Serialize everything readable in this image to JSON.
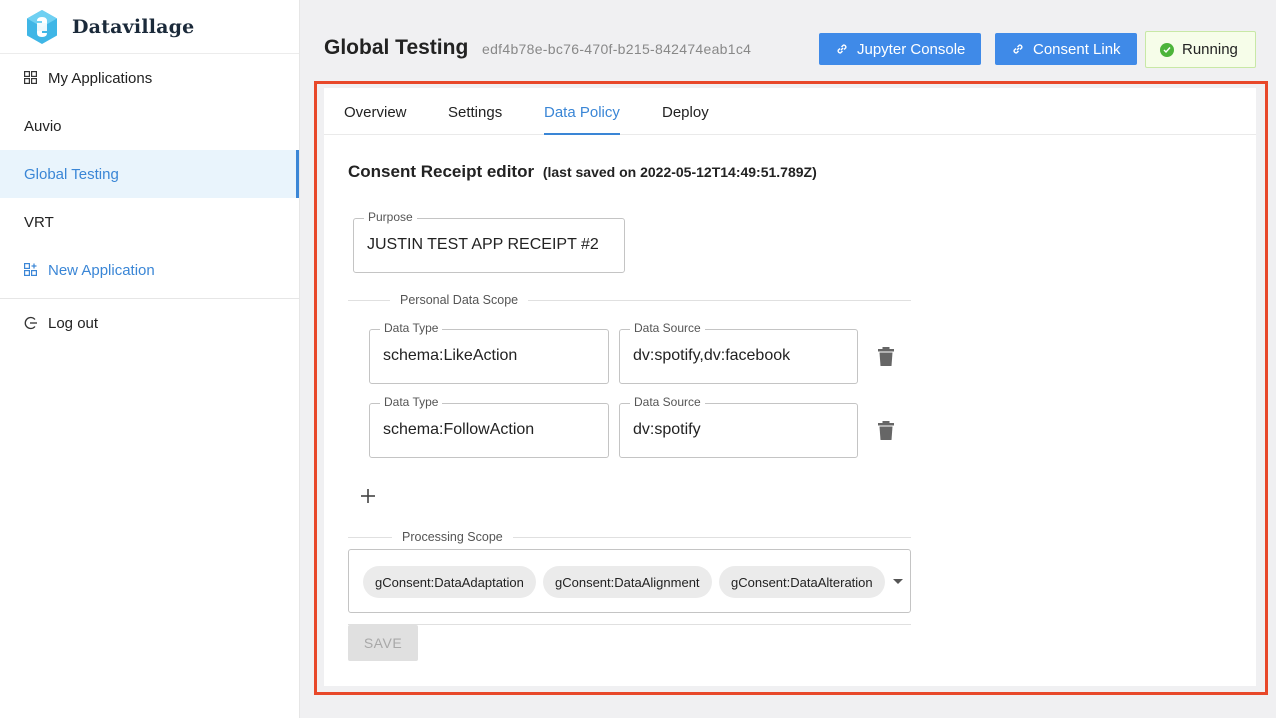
{
  "app": {
    "brand": "Datavillage"
  },
  "sidebar": {
    "items": [
      {
        "label": "My Applications",
        "icon": "grid-icon"
      },
      {
        "label": "Auvio"
      },
      {
        "label": "Global Testing",
        "active": true
      },
      {
        "label": "VRT"
      },
      {
        "label": "New Application",
        "icon": "add-app-icon"
      }
    ],
    "logout": {
      "label": "Log out",
      "icon": "logout-icon"
    }
  },
  "header": {
    "title": "Global Testing",
    "id": "edf4b78e-bc76-470f-b215-842474eab1c4",
    "jupyter_label": "Jupyter Console",
    "consent_label": "Consent Link",
    "status": "Running"
  },
  "tabs": [
    {
      "label": "Overview"
    },
    {
      "label": "Settings"
    },
    {
      "label": "Data Policy",
      "active": true
    },
    {
      "label": "Deploy"
    }
  ],
  "editor": {
    "title": "Consent Receipt editor",
    "subtitle": "(last saved on 2022-05-12T14:49:51.789Z)",
    "purpose": {
      "label": "Purpose",
      "value": "JUSTIN TEST APP RECEIPT #2"
    },
    "personal_scope_label": "Personal Data Scope",
    "scope_rows": [
      {
        "type_label": "Data Type",
        "type_value": "schema:LikeAction",
        "source_label": "Data Source",
        "source_value": "dv:spotify,dv:facebook"
      },
      {
        "type_label": "Data Type",
        "type_value": "schema:FollowAction",
        "source_label": "Data Source",
        "source_value": "dv:spotify"
      }
    ],
    "processing_scope_label": "Processing Scope",
    "processing_chips": [
      "gConsent:DataAdaptation",
      "gConsent:DataAlignment",
      "gConsent:DataAlteration"
    ],
    "save_label": "SAVE"
  },
  "colors": {
    "accent": "#3a86d6",
    "button": "#3f8ae8",
    "highlight": "#e8482a",
    "status_ok": "#4cb43a"
  }
}
